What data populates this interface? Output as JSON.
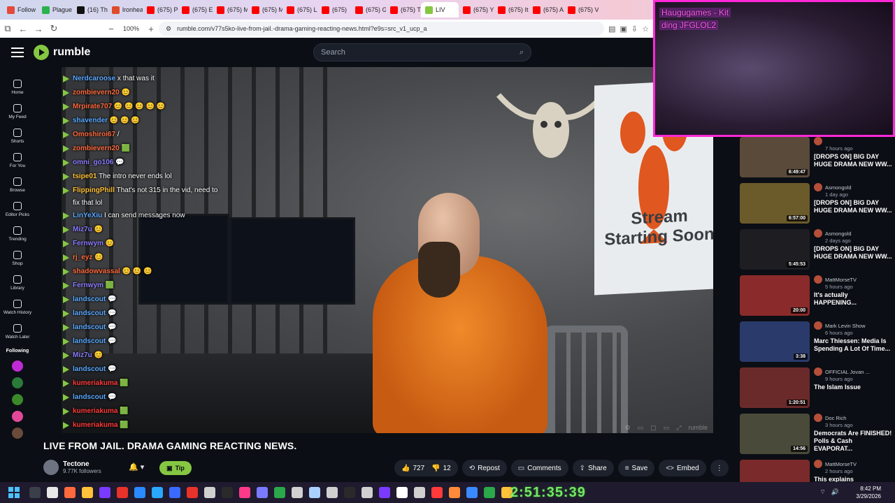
{
  "browser": {
    "tabs": [
      {
        "label": "Follow",
        "color": "#e5483c"
      },
      {
        "label": "Plague",
        "color": "#2bb24c"
      },
      {
        "label": "(16) Th",
        "color": "#111111"
      },
      {
        "label": "lronhea",
        "color": "#e04b2a"
      },
      {
        "label": "(675) Pl",
        "color": "#ff0000"
      },
      {
        "label": "(675) E",
        "color": "#ff0000"
      },
      {
        "label": "(675) M",
        "color": "#ff0000"
      },
      {
        "label": "(675) M",
        "color": "#ff0000"
      },
      {
        "label": "(675) Li",
        "color": "#ff0000"
      },
      {
        "label": "(675)",
        "color": "#ff0000"
      },
      {
        "label": "(675) G",
        "color": "#ff0000"
      },
      {
        "label": "(675) Ti",
        "color": "#ff0000"
      },
      {
        "label": "LIV",
        "color": "#85c742",
        "active": true
      },
      {
        "label": "(675) Yt",
        "color": "#ff0000"
      },
      {
        "label": "(675) It",
        "color": "#ff0000"
      },
      {
        "label": "(675) A",
        "color": "#ff0000"
      },
      {
        "label": "(675) V",
        "color": "#ff0000"
      }
    ],
    "zoom": "100%",
    "url": "rumble.com/v77s5ko-live-from-jail.-drama-gaming-reacting-news.html?e9s=src_v1_ucp_a"
  },
  "header": {
    "logo_text": "rumble",
    "search_placeholder": "Search"
  },
  "nav": {
    "items": [
      {
        "label": "Home"
      },
      {
        "label": "My Feed"
      },
      {
        "label": "Shorts"
      },
      {
        "label": "For You"
      },
      {
        "label": "Browse"
      },
      {
        "label": "Editor Picks"
      },
      {
        "label": "Trending"
      },
      {
        "label": "Shop"
      },
      {
        "label": "Library"
      },
      {
        "label": "Watch History"
      },
      {
        "label": "Watch Later"
      }
    ],
    "following_label": "Following"
  },
  "chat": {
    "messages": [
      {
        "user": "Nerdcaroose",
        "color": "#5aa9ff",
        "msg": "x that was it"
      },
      {
        "user": "zombievern20",
        "color": "#ff6a3d",
        "msg": "😊"
      },
      {
        "user": "Mrpirate707",
        "color": "#ff6a3d",
        "msg": "😊 😊 😊 😊 😊"
      },
      {
        "user": "shavender",
        "color": "#5aa9ff",
        "msg": "😊 😊 😊"
      },
      {
        "user": "Omoshiroi67",
        "color": "#ff6a3d",
        "msg": "/"
      },
      {
        "user": "zombievern20",
        "color": "#ff6a3d",
        "msg": "🟩"
      },
      {
        "user": "omni_go106",
        "color": "#8a7dff",
        "msg": "💬"
      },
      {
        "user": "tsipe01",
        "color": "#ffc23a",
        "msg": "The intro never ends lol"
      },
      {
        "user": "FlippingPhill",
        "color": "#ffc23a",
        "msg": "That's not 315 in the vid, need to fix that lol"
      },
      {
        "user": "LinYeXiu",
        "color": "#5aa9ff",
        "msg": "I can send messages now"
      },
      {
        "user": "Miz7u",
        "color": "#8a7dff",
        "msg": "😊"
      },
      {
        "user": "Fernwym",
        "color": "#8a7dff",
        "msg": "😊"
      },
      {
        "user": "rj_eyz",
        "color": "#ff6a3d",
        "msg": "😊"
      },
      {
        "user": "shadowvassal",
        "color": "#ff6a3d",
        "msg": "😊 😊 😊"
      },
      {
        "user": "Fernwym",
        "color": "#8a7dff",
        "msg": "🟩"
      },
      {
        "user": "landscout",
        "color": "#5aa9ff",
        "msg": "💬"
      },
      {
        "user": "landscout",
        "color": "#5aa9ff",
        "msg": "💬"
      },
      {
        "user": "landscout",
        "color": "#5aa9ff",
        "msg": "💬"
      },
      {
        "user": "landscout",
        "color": "#5aa9ff",
        "msg": "💬"
      },
      {
        "user": "Miz7u",
        "color": "#8a7dff",
        "msg": "😊"
      },
      {
        "user": "landscout",
        "color": "#5aa9ff",
        "msg": "💬"
      },
      {
        "user": "kumeriakuma",
        "color": "#ff3a3a",
        "msg": "🟩"
      },
      {
        "user": "landscout",
        "color": "#5aa9ff",
        "msg": "💬"
      },
      {
        "user": "kumeriakuma",
        "color": "#ff3a3a",
        "msg": "🟩"
      },
      {
        "user": "kumeriakuma",
        "color": "#ff3a3a",
        "msg": "🟩"
      }
    ]
  },
  "video": {
    "poster_text": "Stream Starting Soon",
    "title": "LIVE FROM JAIL. DRAMA GAMING REACTING NEWS.",
    "channel_name": "Tectone",
    "followers": "9.77K followers",
    "tip_label": "Tip",
    "likes": "727",
    "dislikes": "12",
    "repost_label": "Repost",
    "comments_label": "Comments",
    "share_label": "Share",
    "save_label": "Save",
    "embed_label": "Embed",
    "control_brand": "rumble"
  },
  "webcam": {
    "line1": "Haugugames - Kit",
    "line2": "ding JFGLOL2"
  },
  "recommendations": [
    {
      "channel": "",
      "ago": "7 hours ago",
      "title": "[DROPS ON] BIG DAY HUGE DRAMA NEW WW...",
      "duration": "6:49:47",
      "thumb": "#5a4a3a"
    },
    {
      "channel": "Asmongold",
      "ago": "1 day ago",
      "title": "[DROPS ON] BIG DAY HUGE DRAMA NEW WW...",
      "duration": "6:57:00",
      "thumb": "#6b5a2a"
    },
    {
      "channel": "Asmongold",
      "ago": "2 days ago",
      "title": "[DROPS ON] BIG DAY HUGE DRAMA NEW WW...",
      "duration": "5:45:53",
      "thumb": "#1d1d22"
    },
    {
      "channel": "MattMorseTV",
      "ago": "5 hours ago",
      "title": "It's actually HAPPENING...",
      "duration": "20:00",
      "thumb": "#8a2a2a"
    },
    {
      "channel": "Mark Levin Show",
      "ago": "6 hours ago",
      "title": "Marc Thiessen: Media Is Spending A Lot Of Time...",
      "duration": "3:38",
      "thumb": "#2a3a6b"
    },
    {
      "channel": "OFFICIAL Jovan ...",
      "ago": "9 hours ago",
      "title": "The Islam Issue",
      "duration": "1:20:51",
      "thumb": "#6b2a2a"
    },
    {
      "channel": "Doc Rich",
      "ago": "3 hours ago",
      "title": "Democrats Are FINISHED! Polls & Cash EVAPORAT...",
      "duration": "14:56",
      "thumb": "#4a4a3a"
    },
    {
      "channel": "MattMorseTV",
      "ago": "2 hours ago",
      "title": "This explains EVERYTHING...",
      "duration": "",
      "thumb": "#7a2a2a"
    }
  ],
  "taskbar": {
    "time": "8:42 PM",
    "date": "3/29/2026",
    "overlay_clock": "2:51:35:39"
  }
}
